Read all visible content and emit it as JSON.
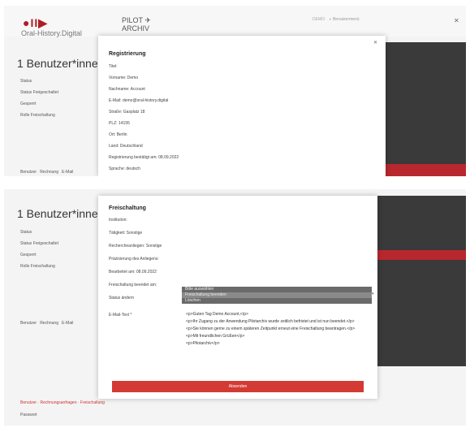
{
  "app": {
    "logo_symbol": "●II▶",
    "brand_name": "Oral-History.Digital",
    "pilot_line1": "PILOT ✈",
    "pilot_line2": "ARCHIV",
    "header_right_1": "DEMO",
    "header_right_2": "◐ Benutzermenü"
  },
  "background": {
    "page_title": "1 Benutzer*inner",
    "filter_labels": [
      "Status",
      "Status Freigeschaltet",
      "Gesperrt",
      "Rolle Freischaltung"
    ],
    "footer_text": [
      "Benutzer",
      "Rechnung",
      "E-Mail"
    ]
  },
  "panel_a": {
    "modal_title": "Registrierung",
    "rows": [
      "Titel:",
      "Vorname: Demo",
      "Nachname: Account",
      "E-Mail: demo@oral-history.digital",
      "Straße: Gasplatz 18",
      "PLZ: 14195",
      "Ort: Berlin",
      "Land: Deutschland",
      "Registrierung bestätigt am: 08.09.2022",
      "Sprache: deutsch"
    ],
    "close_label": "✕"
  },
  "panel_b": {
    "modal_title": "Freischaltung",
    "rows": [
      "Institution:",
      "Tätigkeit: Sonstige",
      "Rechercheanliegen: Sonstige",
      "Präzisierung des Anliegens:",
      "Bearbeitet am: 08.09.2022",
      "Freischaltung beendet am:"
    ],
    "status_label": "Status ändern",
    "status_options": [
      "Bitte auswählen",
      "Freischaltung beenden",
      "Löschen"
    ],
    "email_label": "E-Mail-Text *",
    "email_lines": [
      "<p>Guten Tag Demo Account,</p>",
      "<p>Ihr Zugang zu der Anwendung Pilotarchiv wurde zeitlich befristet und ist nun beendet.</p>",
      "<p>Sie können gerne zu einem späteren Zeitpunkt erneut eine Freischaltung beantragen.</p>",
      "<p>Mit freundlichen Grüßen</p>",
      "<p>Pilotarchiv</p>"
    ],
    "submit_label": "Absenden",
    "footer_left": "Benutzer · Rechnungsanfragen · Freischaltung",
    "footer_left2": "Passwort"
  }
}
